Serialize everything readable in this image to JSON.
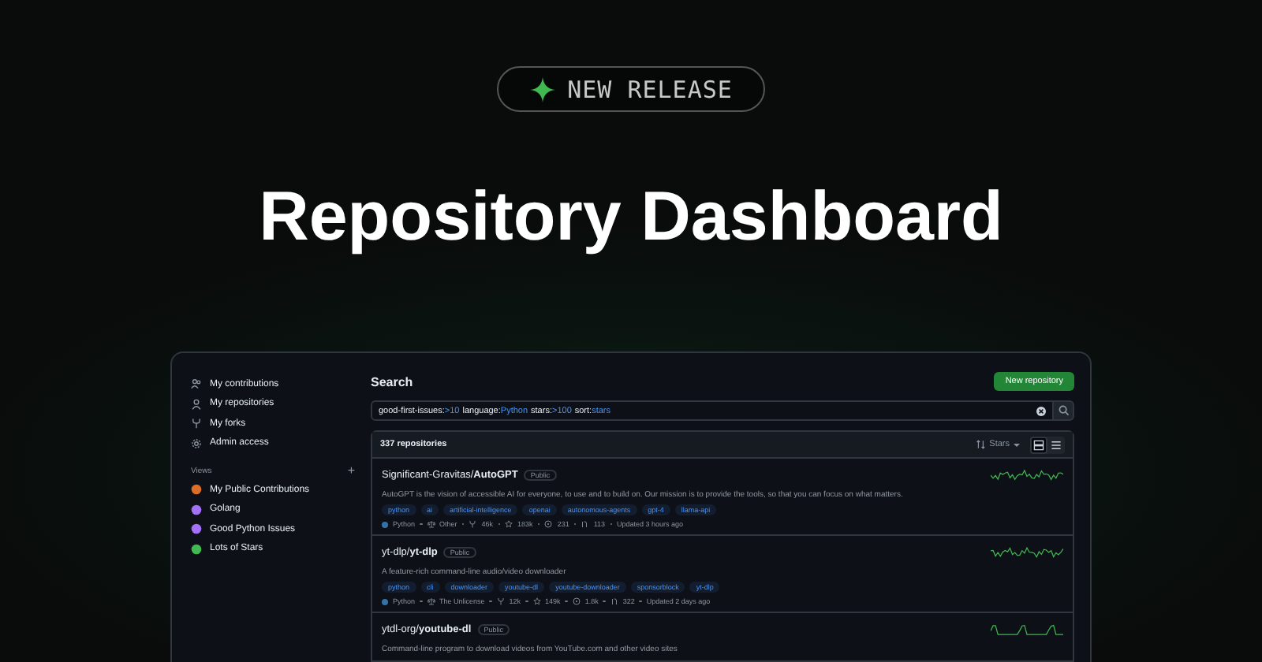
{
  "badge": {
    "label": "NEW RELEASE"
  },
  "headline": "Repository Dashboard",
  "sidebar": {
    "items": [
      {
        "label": "My contributions",
        "kind": "people"
      },
      {
        "label": "My repositories",
        "kind": "person"
      },
      {
        "label": "My forks",
        "kind": "fork"
      },
      {
        "label": "Admin access",
        "kind": "gear"
      }
    ],
    "views_heading": "Views",
    "add_label": "+",
    "views": [
      {
        "label": "My Public Contributions",
        "color": "#db6d28"
      },
      {
        "label": "Golang",
        "color": "#a371f7"
      },
      {
        "label": "Good Python Issues",
        "color": "#a371f7"
      },
      {
        "label": "Lots of Stars",
        "color": "#3fb950"
      }
    ]
  },
  "main": {
    "title": "Search",
    "new_button": "New repository",
    "query": [
      {
        "key": "good-first-issues:",
        "value": ">10"
      },
      {
        "key": "language:",
        "value": "Python"
      },
      {
        "key": "stars:",
        "value": ">100"
      },
      {
        "key": "sort:",
        "value": "stars"
      }
    ],
    "count": "337 repositories",
    "sort_label": "Stars",
    "view_mode": [
      {
        "kind": "cards",
        "selected": true
      },
      {
        "kind": "list",
        "selected": false
      }
    ],
    "repos": [
      {
        "owner": "Significant-Gravitas/",
        "name": "AutoGPT",
        "visibility": "Public",
        "description": "AutoGPT is the vision of accessible AI for everyone, to use and to build on. Our mission is to provide the tools, so that you can focus on what matters.",
        "topics": [
          "python",
          "ai",
          "artificial-intelligence",
          "openai",
          "autonomous-agents",
          "gpt-4",
          "llama-api"
        ],
        "language": "Python",
        "license": "Other",
        "forks": "46k",
        "stars": "183k",
        "issues": "231",
        "prs": "113",
        "updated": "Updated 3 hours ago"
      },
      {
        "owner": "yt-dlp/",
        "name": "yt-dlp",
        "visibility": "Public",
        "description": "A feature-rich command-line audio/video downloader",
        "topics": [
          "python",
          "cli",
          "downloader",
          "youtube-dl",
          "youtube-downloader",
          "sponsorblock",
          "yt-dlp"
        ],
        "language": "Python",
        "license": "The Unlicense",
        "forks": "12k",
        "stars": "149k",
        "issues": "1.8k",
        "prs": "322",
        "updated": "Updated 2 days ago"
      },
      {
        "owner": "ytdl-org/",
        "name": "youtube-dl",
        "visibility": "Public",
        "description": "Command-line program to download videos from YouTube.com and other video sites"
      }
    ]
  }
}
